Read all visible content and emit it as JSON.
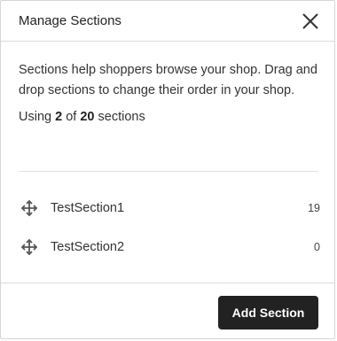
{
  "dialog": {
    "title": "Manage Sections",
    "close_icon": "close-icon"
  },
  "body": {
    "description": "Sections help shoppers browse your shop. Drag and drop sections to change their order in your shop.",
    "usage_prefix": "Using ",
    "used": "2",
    "usage_middle": " of ",
    "total": "20",
    "usage_suffix": " sections"
  },
  "sections": [
    {
      "name": "TestSection1",
      "count": "19",
      "icon": "drag-handle-icon"
    },
    {
      "name": "TestSection2",
      "count": "0",
      "icon": "drag-handle-icon"
    }
  ],
  "footer": {
    "add_button_label": "Add Section"
  },
  "colors": {
    "button_bg": "#222222",
    "button_text": "#ffffff",
    "divider": "#dcdcdc"
  }
}
